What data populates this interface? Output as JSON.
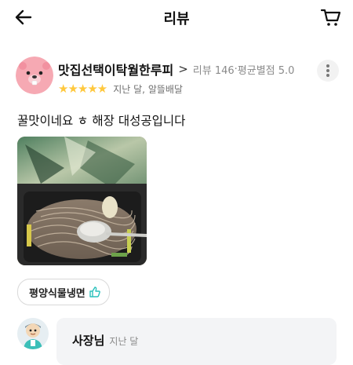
{
  "header": {
    "title": "리뷰",
    "back_icon": "arrow-left-icon",
    "cart_icon": "cart-icon"
  },
  "reviewer": {
    "nickname": "맛집선택이탁월한루피",
    "review_count_label": "리뷰 146",
    "avg_rating_label": "평균별점 5.0",
    "rating": 5,
    "rating_max": 5,
    "stars_text": "★★★★★",
    "posted": "지난 달, 알뜰배달",
    "chevron": ">"
  },
  "review": {
    "text": "꿀맛이네요 ㅎ 해장 대성공입니다"
  },
  "menu_tag": {
    "label": "평양식물냉면"
  },
  "owner_reply": {
    "name": "사장님",
    "time": "지난 달"
  },
  "colors": {
    "star": "#ffc83d",
    "like_icon": "#2ac1bc",
    "meta_text": "#8a8a8a"
  }
}
